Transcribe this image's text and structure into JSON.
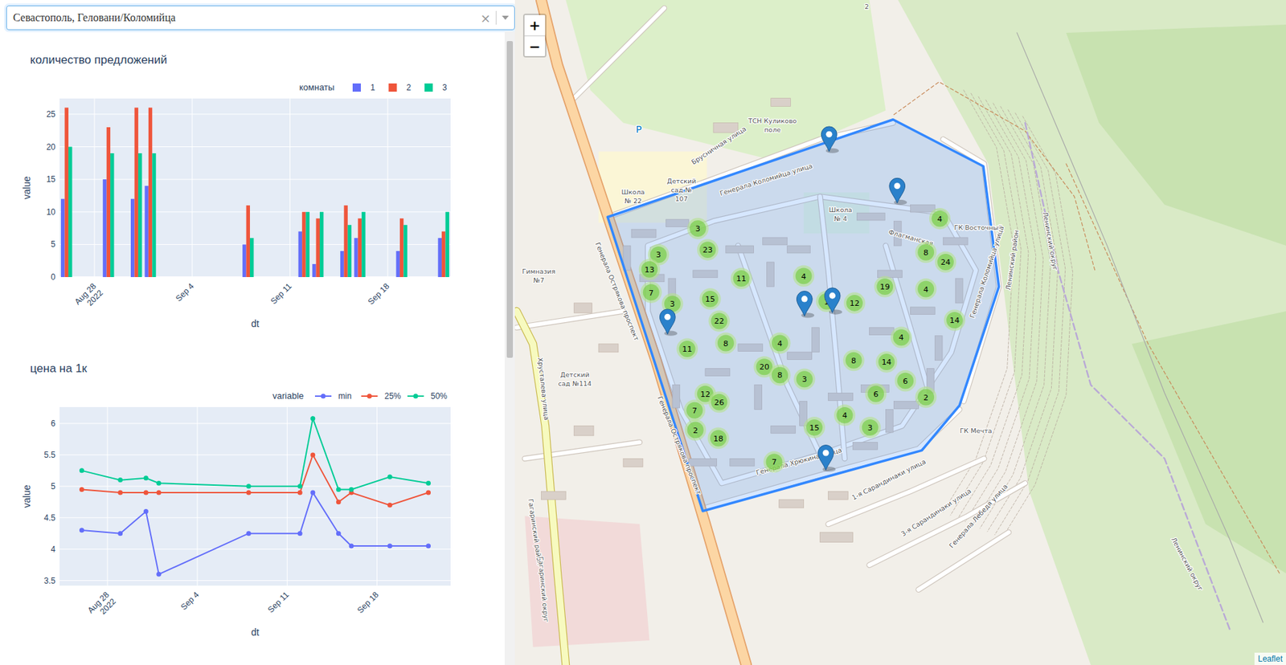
{
  "filter": {
    "value": "Севастополь, Геловани/Коломийца",
    "clear": "×"
  },
  "scrollbar": {
    "level": 0.5
  },
  "chart_counts": {
    "title": "количество предложений",
    "legend_title": "комнаты",
    "x_title": "dt",
    "y_title": "value",
    "y_ticks": [
      "0",
      "5",
      "10",
      "15",
      "20",
      "25"
    ],
    "x_ticks": [
      {
        "date": "2022-08-28",
        "label": "Aug 28",
        "sublabel": "2022"
      },
      {
        "date": "2022-09-04",
        "label": "Sep 4"
      },
      {
        "date": "2022-09-11",
        "label": "Sep 11"
      },
      {
        "date": "2022-09-18",
        "label": "Sep 18"
      }
    ],
    "dates": [
      "2022-08-26",
      "2022-08-29",
      "2022-08-31",
      "2022-09-01",
      "2022-09-08",
      "2022-09-12",
      "2022-09-13",
      "2022-09-15",
      "2022-09-16",
      "2022-09-19",
      "2022-09-22"
    ],
    "series": [
      {
        "name": "1",
        "color": "#636efa",
        "values": [
          12,
          15,
          12,
          14,
          5,
          7,
          2,
          4,
          6,
          4,
          6
        ]
      },
      {
        "name": "2",
        "color": "#ef553b",
        "values": [
          26,
          23,
          26,
          26,
          11,
          10,
          9,
          11,
          9,
          9,
          7
        ]
      },
      {
        "name": "3",
        "color": "#00cc96",
        "values": [
          20,
          19,
          19,
          19,
          6,
          10,
          10,
          8,
          10,
          8,
          10
        ]
      }
    ]
  },
  "chart_price": {
    "title": "цена на 1к",
    "legend_title": "variable",
    "x_title": "dt",
    "y_title": "value",
    "y_ticks": [
      "3.5",
      "4",
      "4.5",
      "5",
      "5.5",
      "6"
    ],
    "x_ticks": [
      {
        "date": "2022-08-28",
        "label": "Aug 28",
        "sublabel": "2022"
      },
      {
        "date": "2022-09-04",
        "label": "Sep 4"
      },
      {
        "date": "2022-09-11",
        "label": "Sep 11"
      },
      {
        "date": "2022-09-18",
        "label": "Sep 18"
      }
    ],
    "dates": [
      "2022-08-26",
      "2022-08-29",
      "2022-08-31",
      "2022-09-01",
      "2022-09-08",
      "2022-09-12",
      "2022-09-13",
      "2022-09-15",
      "2022-09-16",
      "2022-09-19",
      "2022-09-22"
    ],
    "series": [
      {
        "name": "min",
        "color": "#636efa",
        "values": [
          4.3,
          4.25,
          4.6,
          3.6,
          4.25,
          4.25,
          4.9,
          4.25,
          4.05,
          4.05,
          4.05
        ]
      },
      {
        "name": "25%",
        "color": "#ef553b",
        "values": [
          4.95,
          4.9,
          4.9,
          4.9,
          4.9,
          4.9,
          5.5,
          4.75,
          4.9,
          4.7,
          4.9
        ]
      },
      {
        "name": "50%",
        "color": "#00cc96",
        "values": [
          5.25,
          5.1,
          5.13,
          5.05,
          5.0,
          5.0,
          6.08,
          4.95,
          4.95,
          5.15,
          5.05
        ]
      }
    ]
  },
  "map": {
    "zoom_in": "+",
    "zoom_out": "−",
    "attribution": "Leaflet",
    "area": {
      "color": "#3388ff"
    },
    "clusters": [
      {
        "count": "3"
      },
      {
        "count": "23"
      },
      {
        "count": "3"
      },
      {
        "count": "13"
      },
      {
        "count": "7"
      },
      {
        "count": "3"
      },
      {
        "count": "15"
      },
      {
        "count": "22"
      },
      {
        "count": "11"
      },
      {
        "count": "8"
      },
      {
        "count": "11"
      },
      {
        "count": "4"
      },
      {
        "count": "4"
      },
      {
        "count": "8"
      },
      {
        "count": "24"
      },
      {
        "count": "19"
      },
      {
        "count": "4"
      },
      {
        "count": "12"
      },
      {
        "count": "1"
      },
      {
        "count": "14"
      },
      {
        "count": "4"
      },
      {
        "count": "4"
      },
      {
        "count": "14"
      },
      {
        "count": "8"
      },
      {
        "count": "20"
      },
      {
        "count": "8"
      },
      {
        "count": "3"
      },
      {
        "count": "6"
      },
      {
        "count": "6"
      },
      {
        "count": "2"
      },
      {
        "count": "12"
      },
      {
        "count": "26"
      },
      {
        "count": "7"
      },
      {
        "count": "2"
      },
      {
        "count": "18"
      },
      {
        "count": "4"
      },
      {
        "count": "15"
      },
      {
        "count": "3"
      },
      {
        "count": "7"
      }
    ],
    "markers": [
      {
        "kind": "pin"
      },
      {
        "kind": "pin"
      },
      {
        "kind": "pin"
      },
      {
        "kind": "pin"
      },
      {
        "kind": "pin"
      },
      {
        "kind": "pin"
      }
    ],
    "labels": [
      "Генерала Коломийца улица",
      "ТСН Куликово",
      "поле",
      "Брусничная улица",
      "Школа",
      "№ 4",
      "Школа",
      "№ 22",
      "Детский",
      "сад №",
      "107",
      "Гимназия",
      "№7",
      "Детский",
      "сад №114",
      "ГК Восточный",
      "ГК Мечта",
      "Генерала Острякова проспект",
      "Генерала Острякова проспект",
      "Флагманская",
      "Генерала Коломийца улица",
      "Хрусталева улица",
      "Генерала Хрюкина улица",
      "1-я Сарандинаки улица",
      "3-я Сарандинаки улица",
      "Генерала Лебедя улица",
      "Ленинский район",
      "Ленинский округ",
      "Ленинский округ",
      "Гагаринский район",
      "Гагаринский округ",
      "P",
      "2"
    ]
  }
}
